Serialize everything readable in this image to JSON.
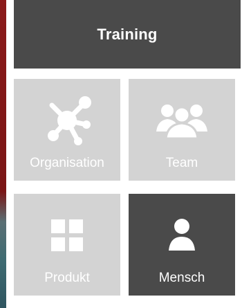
{
  "header": {
    "title": "Training"
  },
  "tiles": [
    {
      "label": "Organisation",
      "icon": "network-icon",
      "active": false
    },
    {
      "label": "Team",
      "icon": "group-icon",
      "active": false
    },
    {
      "label": "Produkt",
      "icon": "grid-icon",
      "active": false
    },
    {
      "label": "Mensch",
      "icon": "person-icon",
      "active": true
    }
  ],
  "colors": {
    "header_bg": "#4a4a4a",
    "tile_bg": "#d3d3d3",
    "tile_active_bg": "#4a4a4a",
    "text": "#ffffff",
    "accent_strip": "#8b1a1a"
  }
}
